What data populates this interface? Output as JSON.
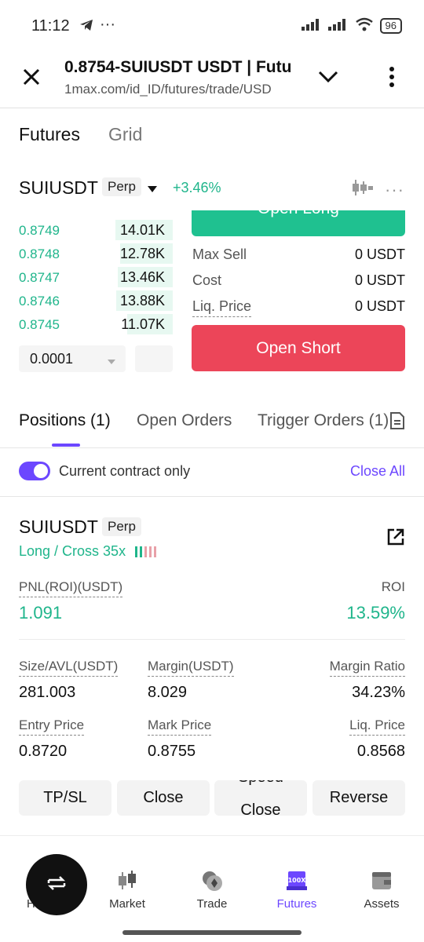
{
  "status": {
    "time": "11:12",
    "dots": "···",
    "battery": "96"
  },
  "browser": {
    "title": "0.8754-SUIUSDT USDT | Futu",
    "url": "1max.com/id_ID/futures/trade/USD"
  },
  "tabs": {
    "futures": "Futures",
    "grid": "Grid"
  },
  "ticker": {
    "symbol": "SUIUSDT",
    "badge": "Perp",
    "change": "+3.46%"
  },
  "orderbook": {
    "bids": [
      {
        "price": "0.8749",
        "size": "14.01K",
        "depth": 0.73
      },
      {
        "price": "0.8748",
        "size": "12.78K",
        "depth": 0.67
      },
      {
        "price": "0.8747",
        "size": "13.46K",
        "depth": 0.7
      },
      {
        "price": "0.8746",
        "size": "13.88K",
        "depth": 0.72
      },
      {
        "price": "0.8745",
        "size": "11.07K",
        "depth": 0.58
      }
    ],
    "precision": "0.0001"
  },
  "trade": {
    "open_long": "Open Long",
    "max_sell_label": "Max Sell",
    "max_sell_value": "0 USDT",
    "cost_label": "Cost",
    "cost_value": "0 USDT",
    "liq_label": "Liq. Price",
    "liq_value": "0 USDT",
    "open_short": "Open Short"
  },
  "position_tabs": {
    "positions": "Positions (1)",
    "open_orders": "Open Orders",
    "trigger_orders": "Trigger Orders (1)"
  },
  "filter": {
    "current_only": "Current contract only",
    "close_all": "Close All"
  },
  "position": {
    "symbol": "SUIUSDT",
    "badge": "Perp",
    "mode": "Long / Cross 35x",
    "pnl_label": "PNL(ROI)(USDT)",
    "pnl_value": "1.091",
    "roi_label": "ROI",
    "roi_value": "13.59%",
    "size_label": "Size/AVL(USDT)",
    "size_value": "281.003",
    "margin_label": "Margin(USDT)",
    "margin_value": "8.029",
    "ratio_label": "Margin Ratio",
    "ratio_value": "34.23%",
    "entry_label": "Entry Price",
    "entry_value": "0.8720",
    "mark_label": "Mark Price",
    "mark_value": "0.8755",
    "liq_label": "Liq. Price",
    "liq_value": "0.8568"
  },
  "actions": {
    "tpsl": "TP/SL",
    "close": "Close",
    "speed_close": "Speed Close",
    "reverse": "Reverse"
  },
  "nav": {
    "home": "Home",
    "market": "Market",
    "trade": "Trade",
    "futures": "Futures",
    "assets": "Assets"
  },
  "colors": {
    "green": "#1fb58b",
    "red": "#e8435a",
    "purple": "#6c47ff",
    "depth": "#e7f8f1"
  }
}
